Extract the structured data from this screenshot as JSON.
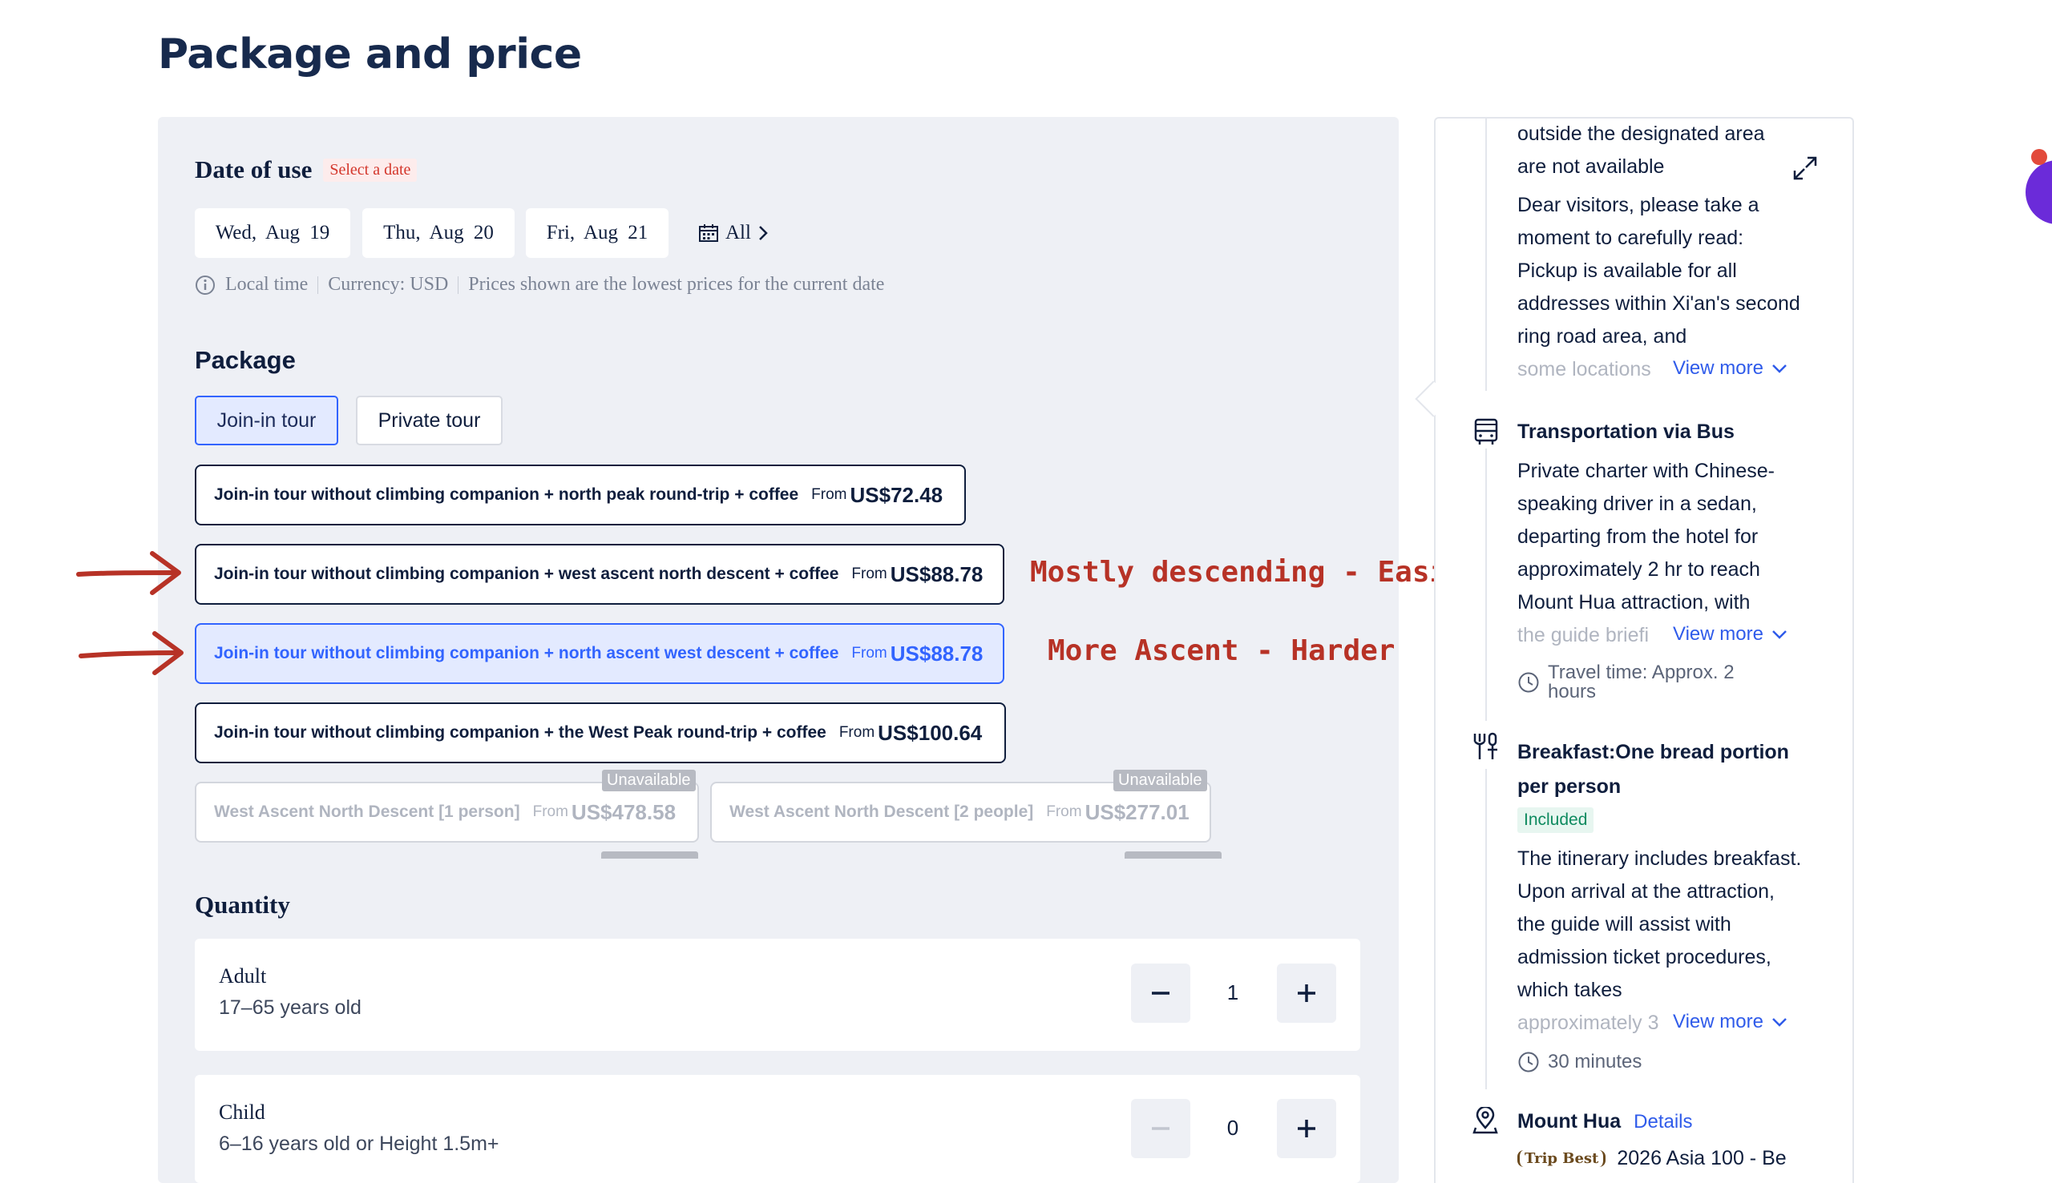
{
  "page_title": "Package and price",
  "date_of_use": {
    "title": "Date of use",
    "badge": "Select a date",
    "dates": [
      "Wed, Aug 19",
      "Thu, Aug 20",
      "Fri, Aug 21"
    ],
    "all_label": "All",
    "info": {
      "local_time": "Local time",
      "currency": "Currency: USD",
      "note": "Prices shown are the lowest prices for the current date"
    }
  },
  "package": {
    "title": "Package",
    "tabs": [
      {
        "label": "Join-in tour",
        "active": true
      },
      {
        "label": "Private tour",
        "active": false
      }
    ],
    "options": [
      {
        "name": "Join-in tour without climbing companion + north peak round-trip + coffee",
        "from": "From",
        "price": "US$72.48",
        "state": "default"
      },
      {
        "name": "Join-in tour without climbing companion + west ascent north descent + coffee",
        "from": "From",
        "price": "US$88.78",
        "state": "default"
      },
      {
        "name": "Join-in tour without climbing companion + north ascent west descent + coffee",
        "from": "From",
        "price": "US$88.78",
        "state": "selected"
      },
      {
        "name": "Join-in tour without climbing companion + the West Peak round-trip + coffee",
        "from": "From",
        "price": "US$100.64",
        "state": "default"
      }
    ],
    "unavailable_options": [
      {
        "name": "West Ascent North Descent [1 person]",
        "from": "From",
        "price": "US$478.58",
        "tag": "Unavailable"
      },
      {
        "name": "West Ascent North Descent [2 people]",
        "from": "From",
        "price": "US$277.01",
        "tag": "Unavailable"
      }
    ]
  },
  "annotations": {
    "note_1": "Mostly descending - Easier",
    "note_2": "More Ascent - Harder",
    "arrow_color": "#b73226"
  },
  "quantity": {
    "title": "Quantity",
    "rows": [
      {
        "label": "Adult",
        "sub": "17–65 years old",
        "value": "1",
        "minus_enabled": true
      },
      {
        "label": "Child",
        "sub": "6–16 years old or Height 1.5m+",
        "value": "0",
        "minus_enabled": false
      }
    ]
  },
  "side": {
    "pickup_tail_1": "outside the designated area",
    "pickup_tail_2": "are not available",
    "pickup_body": "Dear visitors, please take a moment to carefully read: Pickup is available for all addresses within Xi'an's second ring road area, and",
    "pickup_faded": "some locations",
    "view_more": "View more",
    "transport_title": "Transportation via Bus",
    "transport_body": "Private charter with Chinese-speaking driver in a sedan, departing from the hotel for approximately 2 hr to reach Mount Hua attraction, with",
    "transport_faded": "the guide briefi",
    "travel_time": "Travel time: Approx. 2 hours",
    "breakfast_title": "Breakfast:One bread portion per person",
    "included": "Included",
    "breakfast_body": "The itinerary includes breakfast. Upon arrival at the attraction, the guide will assist with admission ticket procedures, which takes",
    "breakfast_faded": "approximately 3",
    "duration": "30 minutes",
    "location_title": "Mount Hua",
    "details": "Details",
    "award_logo": "Trip Best",
    "award_text": "2026 Asia 100 - Be"
  },
  "colors": {
    "accent": "#3264ff",
    "annotation": "#b73226",
    "badge_red": "#d4372c",
    "included_green": "#0e8a5f"
  }
}
